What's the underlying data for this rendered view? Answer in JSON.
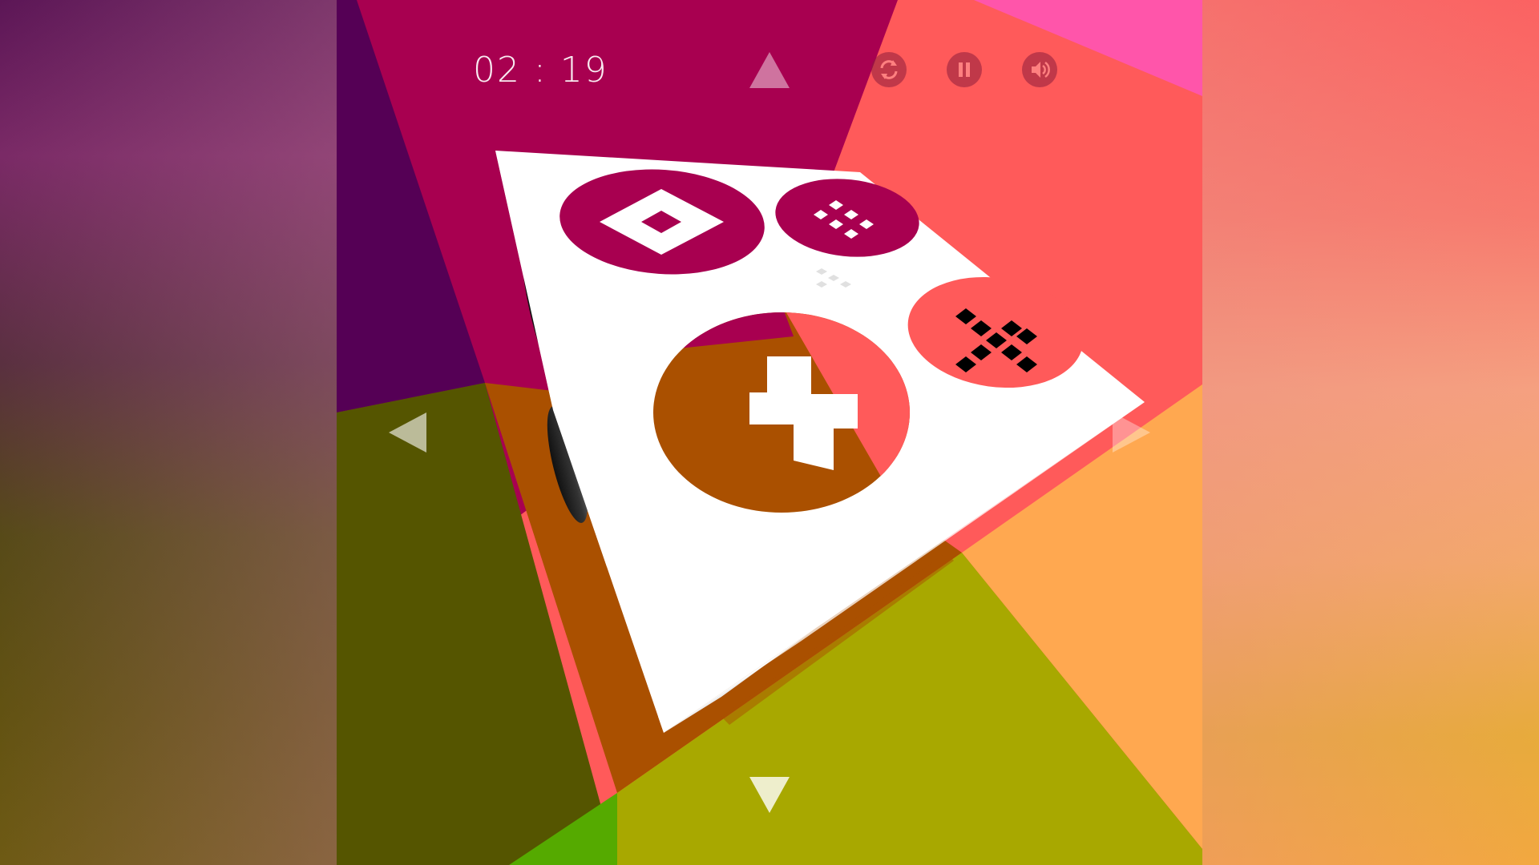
{
  "game": {
    "timer": "02 : 19",
    "controls": {
      "restart_icon": "restart-icon",
      "pause_icon": "pause-icon",
      "sound_icon": "sound-icon"
    },
    "arrows": {
      "up": "arrow-up-icon",
      "down": "arrow-down-icon",
      "left": "arrow-left-icon",
      "right": "arrow-right-icon"
    },
    "cube_symbols": {
      "top_face": [
        "diamond-ring-symbol",
        "small-checker-symbol",
        "cross-symbol",
        "x-checker-symbol"
      ]
    },
    "colors": {
      "magenta": "#a80050",
      "coral": "#ff5a5a",
      "olive": "#555500",
      "orange": "#ffa850",
      "lime": "#a8a800",
      "rust": "#aa5000",
      "plum": "#550055",
      "pink": "#ff55aa",
      "green": "#55aa00"
    }
  }
}
